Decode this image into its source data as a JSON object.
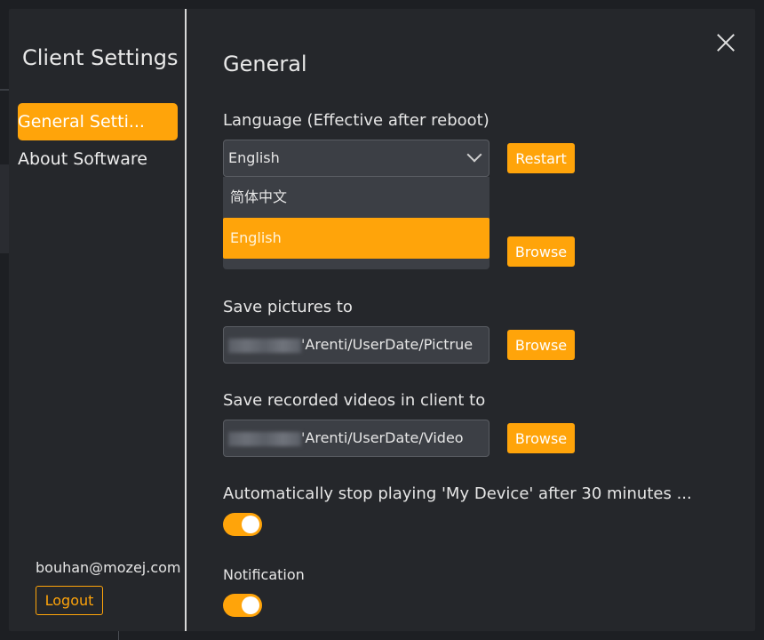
{
  "sidebar": {
    "title": "Client Settings",
    "items": [
      {
        "label": "General Setti..."
      },
      {
        "label": "About Software"
      }
    ],
    "user_email": "bouhan@mozej.com",
    "logout_label": "Logout"
  },
  "main": {
    "section_title": "General",
    "language": {
      "label": "Language (Effective after reboot)",
      "selected": "English",
      "options": [
        "简体中文",
        "English"
      ],
      "restart_label": "Restart"
    },
    "browse_label": "Browse",
    "pictures": {
      "label": "Save pictures to",
      "path": "'Arenti/UserDate/Pictrue"
    },
    "videos": {
      "label": "Save recorded videos in client to",
      "path": "'Arenti/UserDate/Video"
    },
    "autostop": {
      "label": "Automatically stop playing 'My Device' after 30 minutes ...",
      "enabled": true
    },
    "notification": {
      "label": "Notification",
      "enabled": true
    }
  },
  "colors": {
    "accent": "#ffa40a",
    "background": "#25272b",
    "input_bg": "#3c3f45"
  }
}
